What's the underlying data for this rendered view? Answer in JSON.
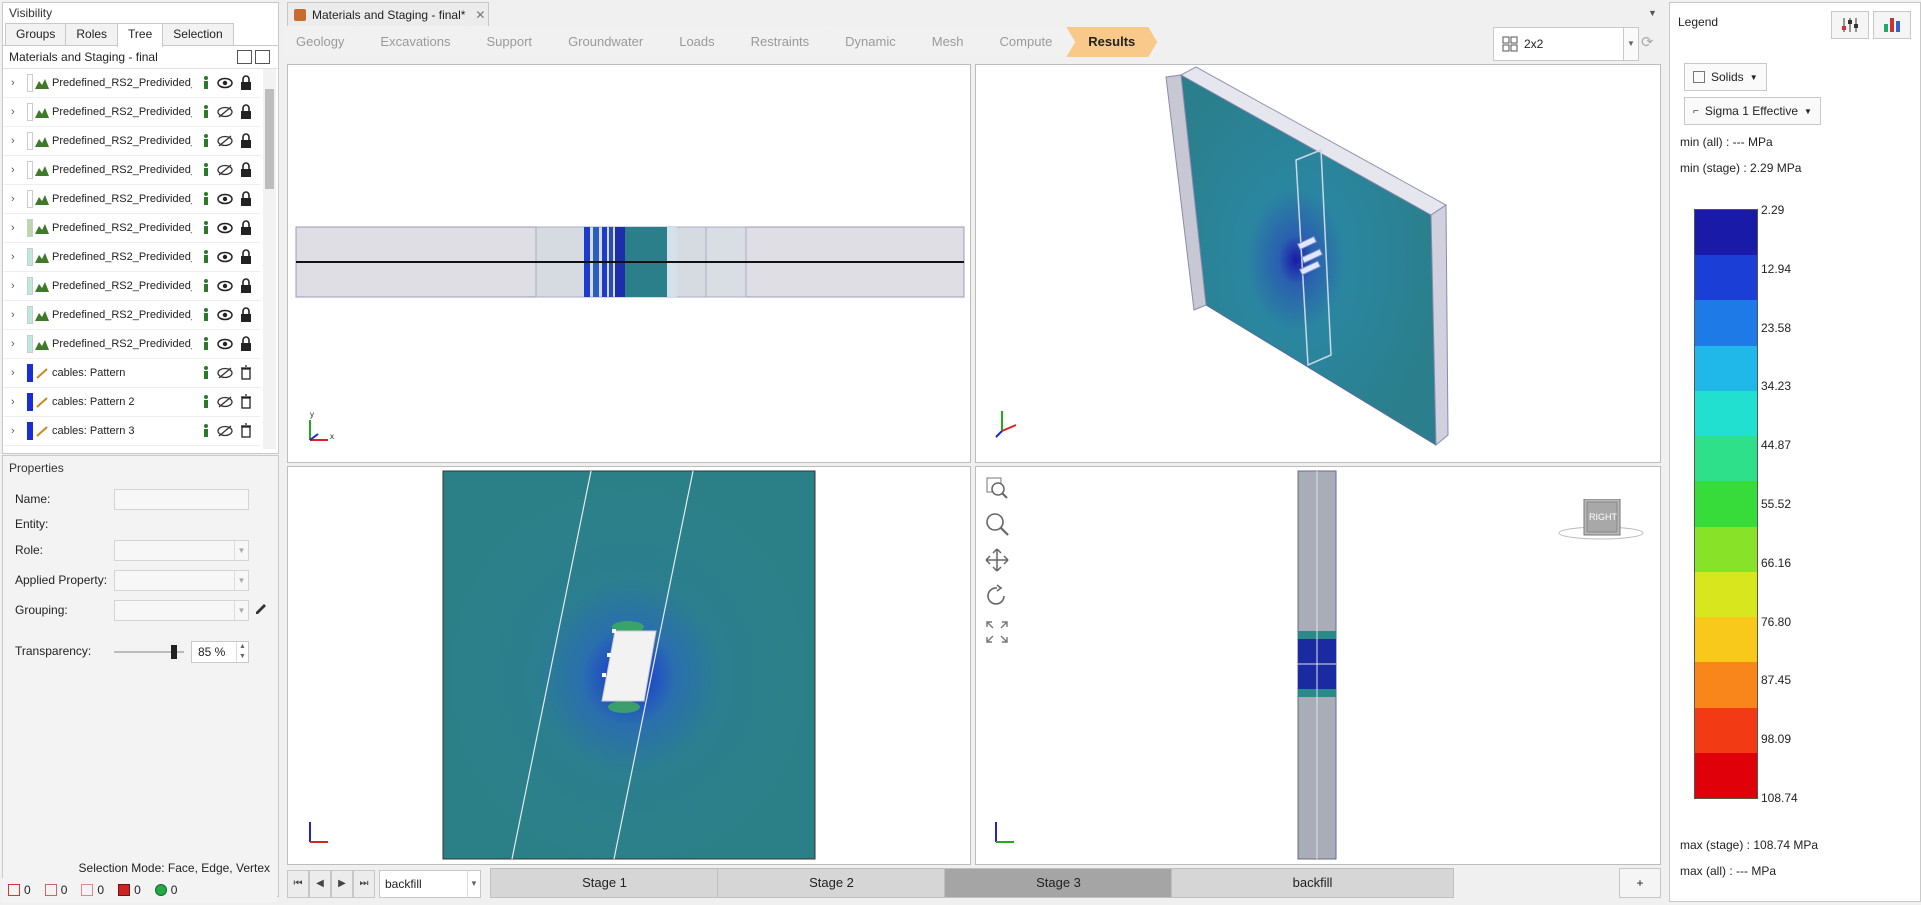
{
  "visibility": {
    "title": "Visibility",
    "tabs": [
      "Groups",
      "Roles",
      "Tree",
      "Selection"
    ],
    "active_tab": "Tree",
    "tree_header": "Materials and Staging - final",
    "rows": [
      {
        "label": "Predefined_RS2_Predivided_",
        "kind": "material",
        "swatch": "#ffffff",
        "visible": true
      },
      {
        "label": "Predefined_RS2_Predivided_",
        "kind": "material",
        "swatch": "#ffffff",
        "visible": false
      },
      {
        "label": "Predefined_RS2_Predivided_",
        "kind": "material",
        "swatch": "#ffffff",
        "visible": false
      },
      {
        "label": "Predefined_RS2_Predivided_",
        "kind": "material",
        "swatch": "#ffffff",
        "visible": false
      },
      {
        "label": "Predefined_RS2_Predivided_",
        "kind": "material",
        "swatch": "#ffffff",
        "visible": true
      },
      {
        "label": "Predefined_RS2_Predivided_",
        "kind": "material",
        "swatch": "#b9d7a8",
        "visible": true
      },
      {
        "label": "Predefined_RS2_Predivided_",
        "kind": "material",
        "swatch": "#bfe8e0",
        "visible": true
      },
      {
        "label": "Predefined_RS2_Predivided_",
        "kind": "material",
        "swatch": "#bfe8e0",
        "visible": true
      },
      {
        "label": "Predefined_RS2_Predivided_",
        "kind": "material",
        "swatch": "#bfe8e0",
        "visible": true
      },
      {
        "label": "Predefined_RS2_Predivided_",
        "kind": "material",
        "swatch": "#bfe8e0",
        "visible": true
      },
      {
        "label": "cables: Pattern",
        "kind": "cable",
        "swatch": "#1a2cd8",
        "visible": false
      },
      {
        "label": "cables: Pattern  2",
        "kind": "cable",
        "swatch": "#1a2cd8",
        "visible": false
      },
      {
        "label": "cables: Pattern  3",
        "kind": "cable",
        "swatch": "#1a2cd8",
        "visible": false
      }
    ]
  },
  "properties": {
    "title": "Properties",
    "name_label": "Name:",
    "entity_label": "Entity:",
    "role_label": "Role:",
    "applied_property_label": "Applied Property:",
    "grouping_label": "Grouping:",
    "transparency_label": "Transparency:",
    "transparency_value": "85 %",
    "transparency_fraction": 0.85,
    "selection_mode": "Selection Mode: Face, Edge, Vertex"
  },
  "status": {
    "counts": [
      "0",
      "0",
      "0",
      "0",
      "0"
    ]
  },
  "document": {
    "tab_title": "Materials and Staging - final*"
  },
  "workflow": {
    "steps": [
      "Geology",
      "Excavations",
      "Support",
      "Groundwater",
      "Loads",
      "Restraints",
      "Dynamic",
      "Mesh",
      "Compute",
      "Results"
    ],
    "active": "Results"
  },
  "layout": {
    "value": "2x2"
  },
  "viewports": {
    "axis_x": "x",
    "axis_y": "y",
    "axis_z": "z",
    "view_cube_label": "RIGHT"
  },
  "stages": {
    "selector_value": "backfill",
    "tabs": [
      "Stage 1",
      "Stage 2",
      "Stage 3",
      "backfill"
    ],
    "active": "Stage 3",
    "add_label": "+"
  },
  "legend": {
    "title": "Legend",
    "solids_label": "Solids",
    "contour_label": "Sigma 1 Effective",
    "min_all": "min (all) :      --- MPa",
    "min_stage": "min (stage) : 2.29 MPa",
    "max_stage": "max (stage) : 108.74 MPa",
    "max_all": "max (all) :      --- MPa",
    "ticks": [
      "2.29",
      "12.94",
      "23.58",
      "34.23",
      "44.87",
      "55.52",
      "66.16",
      "76.80",
      "87.45",
      "98.09",
      "108.74"
    ],
    "colors": [
      "#1a1aa8",
      "#1b3fd6",
      "#1e7ae6",
      "#1fb8e8",
      "#22e0d0",
      "#2ee08a",
      "#38dc3a",
      "#88e228",
      "#d8e61e",
      "#f8c81a",
      "#f8861a",
      "#f23a14",
      "#e0000a"
    ]
  }
}
